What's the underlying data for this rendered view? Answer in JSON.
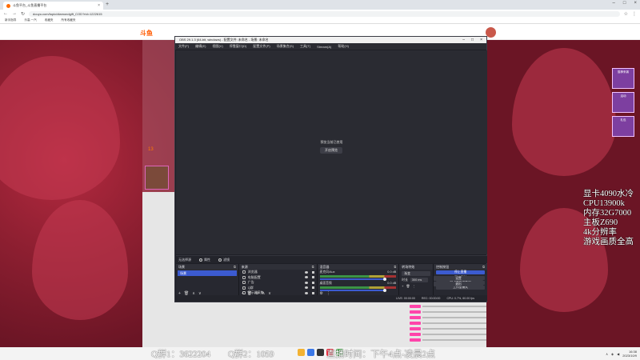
{
  "browser": {
    "tab_title": "斗鱼平台_斗鱼直播平台",
    "url": "douyu.com/topic/diamondgift_COD?rid=1222615",
    "bookmarks": [
      "新手指导",
      "乐高 一汽",
      "收藏夹",
      "所有收藏夹"
    ]
  },
  "site": {
    "logo": "斗鱼",
    "viewer_count": "13"
  },
  "side_ads": [
    "猫神来袭",
    "活动",
    "礼包"
  ],
  "obs": {
    "window_title": "OBS 29.1.3 (64-bit, windows) - 配置文件: 未命名 - 场景: 未命名",
    "menu": [
      "文件(F)",
      "编辑(E)",
      "视图(V)",
      "停靠窗口(D)",
      "配置文件(P)",
      "场景集合(S)",
      "工具(T)",
      "Stream(A)",
      "帮助(H)"
    ],
    "preview_message": "预览当前已禁用",
    "open_properties": "开启预览",
    "toolbar": {
      "no_source": "无选择源",
      "properties": "属性",
      "filters": "滤镜"
    },
    "scenes": {
      "title": "场景",
      "items": [
        "场景"
      ]
    },
    "sources": {
      "title": "来源",
      "items": [
        "浏览器",
        "电脑配置",
        "广告",
        "Q群",
        "显示器采集"
      ]
    },
    "mixer": {
      "title": "混音器",
      "channels": [
        {
          "name": "麦克风/Aux",
          "db": "0.0 dB"
        },
        {
          "name": "桌面音频",
          "db": "0.0 dB"
        }
      ]
    },
    "transitions": {
      "title": "转场特效",
      "type": "渐变",
      "duration_label": "时长",
      "duration": "300 ms"
    },
    "controls": {
      "title": "控制按钮",
      "buttons": [
        "停止直播",
        "开始录制",
        "启动虚拟摄像机",
        "工作室模式",
        "设置",
        "退出"
      ]
    },
    "status": {
      "live": "LIVE: 00:00:00",
      "rec": "REC: 00:00:00",
      "cpu": "CPU: 0.7%, 60.00 fps"
    }
  },
  "overlay": {
    "specs": [
      "显卡4090水冷",
      "CPU13900k",
      "内存32G7000",
      "主板Z690",
      "4k分辨率",
      "游戏画质全高"
    ],
    "ticker": "Q群1：3622204　　Q群2：1059　　　　　　直播时间：下午4点-凌晨2点"
  },
  "clock": {
    "time": "16:38",
    "date": "2023/10/9"
  },
  "colors": {
    "obs_accent": "#3c5bd0",
    "page_bg": "#8a1f2f",
    "brand": "#ff5a00"
  }
}
